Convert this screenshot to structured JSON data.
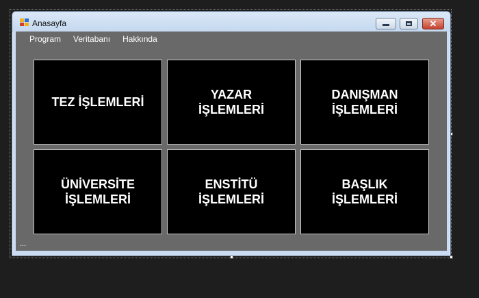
{
  "window": {
    "title": "Anasayfa"
  },
  "menu": {
    "items": [
      "Program",
      "Veritabanı",
      "Hakkında"
    ]
  },
  "tiles": [
    {
      "label": "TEZ İŞLEMLERİ"
    },
    {
      "label": "YAZAR\nİŞLEMLERİ"
    },
    {
      "label": "DANIŞMAN\nİŞLEMLERİ"
    },
    {
      "label": "ÜNİVERSİTE\nİŞLEMLERİ"
    },
    {
      "label": "ENSTİTÜ\nİŞLEMLERİ"
    },
    {
      "label": "BAŞLIK\nİŞLEMLERİ"
    }
  ],
  "status": {
    "text": "..."
  },
  "colors": {
    "client_bg": "#696969",
    "tile_bg": "#000000",
    "tile_text": "#ffffff",
    "close_button": "#c4412c"
  },
  "icons": [
    "app-icon",
    "minimize-icon",
    "maximize-icon",
    "close-icon"
  ]
}
